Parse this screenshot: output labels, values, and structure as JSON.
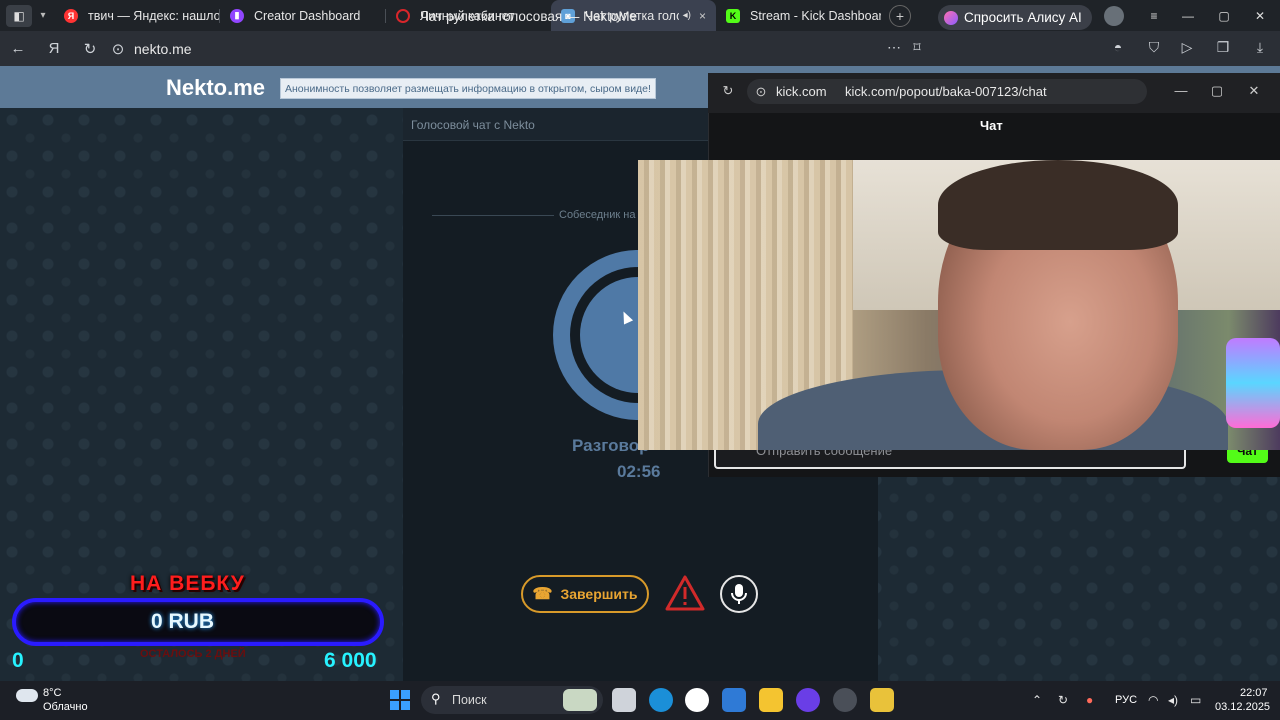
{
  "browser": {
    "tabs": [
      {
        "title": "твич — Яндекс: нашлось",
        "fav_color": "#ff3333",
        "fav_glyph": "Я"
      },
      {
        "title": "Creator Dashboard",
        "fav_color": "#9146ff",
        "fav_glyph": "▮"
      },
      {
        "title": "Личный кабинет",
        "fav_color": "#d8262b",
        "fav_glyph": "○"
      },
      {
        "title": "Чат рулетка голосова",
        "fav_color": "#5fa0d8",
        "fav_glyph": "◙"
      },
      {
        "title": "Stream - Kick Dashboard",
        "fav_color": "#53fc18",
        "fav_glyph": "K"
      }
    ],
    "url_domain": "nekto.me",
    "page_title": "Чат рулетка голосовая — NektoMe",
    "alice_label": "Спросить Алису AI"
  },
  "nekto": {
    "logo": "Nekto.me",
    "notice": "Анонимность позволяет размещать информацию в открытом, сыром виде!",
    "panel_title": "Голосовой чат с Nekto",
    "interlocutor": "Собеседник на",
    "conv_label": "Разговор",
    "timer": "02:56",
    "end_button": "Завершить"
  },
  "kick": {
    "domain": "kick.com",
    "path": "kick.com/popout/baka-007123/chat",
    "chat_title": "Чат",
    "input_placeholder": "Отправить сообщение",
    "send_label": "Чат"
  },
  "overlay": {
    "goal_title": "НА ВЕБКУ",
    "goal_value": "0 RUB",
    "goal_min": "0",
    "goal_max": "6 000",
    "goal_sub": "ОСТАЛОСЬ 2 ДНЕЙ",
    "goal_progress": 0
  },
  "taskbar": {
    "temp": "8°C",
    "weather": "Облачно",
    "search_placeholder": "Поиск",
    "lang": "РУС",
    "time": "22:07",
    "date": "03.12.2025"
  },
  "icons": {
    "tab_close": "×",
    "tab_speaker": "◂)",
    "new_tab": "+",
    "back": "←",
    "yandex": "Я",
    "reload": "↻",
    "shield": "⊙",
    "more": "⋯",
    "bookmark": "⌑",
    "minimize": "—",
    "maximize": "▢",
    "close": "✕",
    "phone": "☎",
    "search": "⚲",
    "chevron_up": "⌃",
    "wifi": "◠",
    "speaker": "◂)",
    "battery": "▭"
  }
}
